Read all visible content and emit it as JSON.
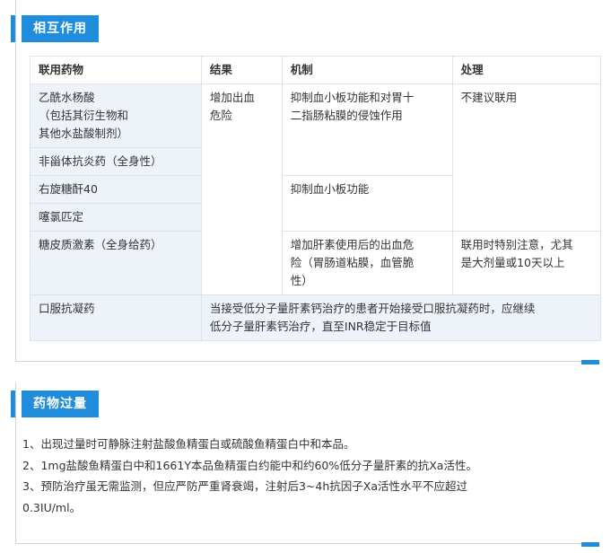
{
  "interaction": {
    "title": "相互作用",
    "headers": [
      "联用药物",
      "结果",
      "机制",
      "处理"
    ],
    "drugs": [
      "乙酰水杨酸\n（包括其衍生物和\n其他水盐酸制剂）",
      "非甾体抗炎药（全身性）",
      "右旋糖酐40",
      "噻氯匹定",
      "糖皮质激素（全身给药）",
      "口服抗凝药"
    ],
    "result": "增加出血\n危险",
    "mechanisms": [
      "抑制血小板功能和对胃十\n二指肠粘膜的侵蚀作用",
      "抑制血小板功能",
      "增加肝素使用后的出血危\n险（胃肠道粘膜，血管脆\n性）"
    ],
    "handling": [
      "不建议联用",
      "联用时特别注意，尤其\n是大剂量或10天以上"
    ],
    "anticoagulant_note": "当接受低分子量肝素钙治疗的患者开始接受口服抗凝药时，应继续\n低分子量肝素钙治疗，直至INR稳定于目标值"
  },
  "overdose": {
    "title": "药物过量",
    "lines": [
      "1、出现过量时可静脉注射盐酸鱼精蛋白或硫酸鱼精蛋白中和本品。",
      "2、1mg盐酸鱼精蛋白中和1661Y本品鱼精蛋白约能中和约60%低分子量肝素的抗Xa活性。",
      "3、预防治疗虽无需监测，但应严防严重肾衰竭，注射后3~4h抗因子Xa活性水平不应超过",
      "0.3IU/ml。"
    ]
  }
}
